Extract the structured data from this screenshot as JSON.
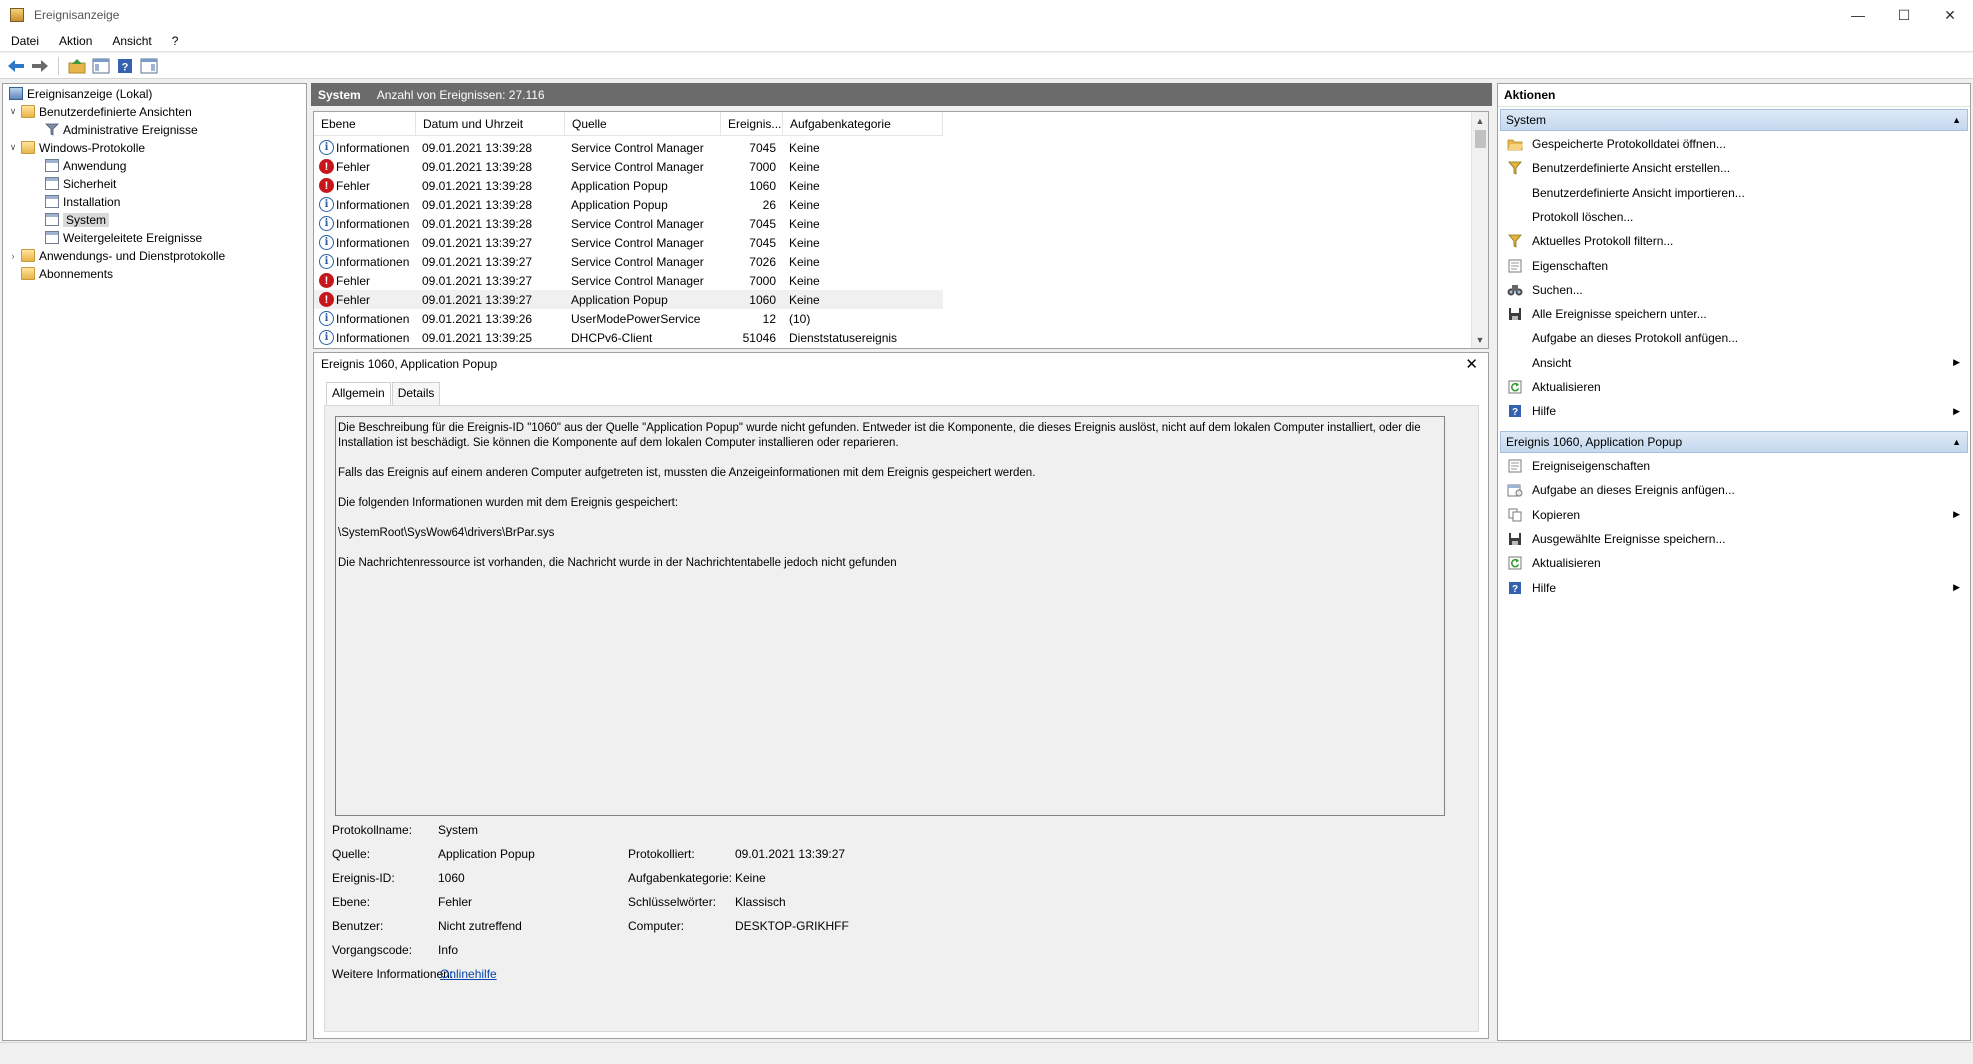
{
  "window": {
    "title": "Ereignisanzeige"
  },
  "menu": [
    "Datei",
    "Aktion",
    "Ansicht",
    "?"
  ],
  "toolbar": [
    "back-icon",
    "forward-icon",
    "up-icon",
    "show-hide-tree-icon",
    "help-icon",
    "show-hide-action-pane-icon"
  ],
  "tree": {
    "root": "Ereignisanzeige (Lokal)",
    "custom_views": "Benutzerdefinierte Ansichten",
    "admin_events": "Administrative Ereignisse",
    "windows_logs": "Windows-Protokolle",
    "app": "Anwendung",
    "security": "Sicherheit",
    "setup": "Installation",
    "system": "System",
    "forwarded": "Weitergeleitete Ereignisse",
    "app_service_logs": "Anwendungs- und Dienstprotokolle",
    "subscriptions": "Abonnements"
  },
  "middle": {
    "log_name": "System",
    "count_text": "Anzahl von Ereignissen: 27.116"
  },
  "events": {
    "columns": [
      "Ebene",
      "Datum und Uhrzeit",
      "Quelle",
      "Ereignis...",
      "Aufgabenkategorie"
    ],
    "rows": [
      {
        "level": "Informationen",
        "type": "info",
        "date": "09.01.2021 13:39:28",
        "source": "Service Control Manager",
        "id": "7045",
        "task": "Keine"
      },
      {
        "level": "Fehler",
        "type": "error",
        "date": "09.01.2021 13:39:28",
        "source": "Service Control Manager",
        "id": "7000",
        "task": "Keine"
      },
      {
        "level": "Fehler",
        "type": "error",
        "date": "09.01.2021 13:39:28",
        "source": "Application Popup",
        "id": "1060",
        "task": "Keine"
      },
      {
        "level": "Informationen",
        "type": "info",
        "date": "09.01.2021 13:39:28",
        "source": "Application Popup",
        "id": "26",
        "task": "Keine"
      },
      {
        "level": "Informationen",
        "type": "info",
        "date": "09.01.2021 13:39:28",
        "source": "Service Control Manager",
        "id": "7045",
        "task": "Keine"
      },
      {
        "level": "Informationen",
        "type": "info",
        "date": "09.01.2021 13:39:27",
        "source": "Service Control Manager",
        "id": "7045",
        "task": "Keine"
      },
      {
        "level": "Informationen",
        "type": "info",
        "date": "09.01.2021 13:39:27",
        "source": "Service Control Manager",
        "id": "7026",
        "task": "Keine"
      },
      {
        "level": "Fehler",
        "type": "error",
        "date": "09.01.2021 13:39:27",
        "source": "Service Control Manager",
        "id": "7000",
        "task": "Keine"
      },
      {
        "level": "Fehler",
        "type": "error",
        "date": "09.01.2021 13:39:27",
        "source": "Application Popup",
        "id": "1060",
        "task": "Keine"
      },
      {
        "level": "Informationen",
        "type": "info",
        "date": "09.01.2021 13:39:26",
        "source": "UserModePowerService",
        "id": "12",
        "task": "(10)"
      },
      {
        "level": "Informationen",
        "type": "info",
        "date": "09.01.2021 13:39:25",
        "source": "DHCPv6-Client",
        "id": "51046",
        "task": "Dienststatusereignis"
      }
    ]
  },
  "detail": {
    "title": "Ereignis 1060, Application Popup",
    "tabs": [
      "Allgemein",
      "Details"
    ],
    "description": [
      "Die Beschreibung für die Ereignis-ID \"1060\" aus der Quelle \"Application Popup\" wurde nicht gefunden. Entweder ist die Komponente, die dieses Ereignis auslöst, nicht auf dem lokalen Computer installiert, oder die Installation ist beschädigt. Sie können die Komponente auf dem lokalen Computer installieren oder reparieren.",
      "Falls das Ereignis auf einem anderen Computer aufgetreten ist, mussten die Anzeigeinformationen mit dem Ereignis gespeichert werden.",
      "Die folgenden Informationen wurden mit dem Ereignis gespeichert:",
      "\\SystemRoot\\SysWow64\\drivers\\BrPar.sys",
      "Die Nachrichtenressource ist vorhanden, die Nachricht wurde in der Nachrichtentabelle jedoch nicht gefunden"
    ],
    "props": {
      "log_name_label": "Protokollname:",
      "log_name": "System",
      "source_label": "Quelle:",
      "source": "Application Popup",
      "logged_label": "Protokolliert:",
      "logged": "09.01.2021 13:39:27",
      "event_id_label": "Ereignis-ID:",
      "event_id": "1060",
      "task_label": "Aufgabenkategorie:",
      "task": "Keine",
      "level_label": "Ebene:",
      "level": "Fehler",
      "keywords_label": "Schlüsselwörter:",
      "keywords": "Klassisch",
      "user_label": "Benutzer:",
      "user": "Nicht zutreffend",
      "computer_label": "Computer:",
      "computer": "DESKTOP-GRIKHFF",
      "opcode_label": "Vorgangscode:",
      "opcode": "Info",
      "more_label": "Weitere Informationen:",
      "more_link": "Onlinehilfe"
    }
  },
  "actions": {
    "title": "Aktionen",
    "section1": "System",
    "items1": [
      {
        "label": "Gespeicherte Protokolldatei öffnen...",
        "icon": "open-folder-icon"
      },
      {
        "label": "Benutzerdefinierte Ansicht erstellen...",
        "icon": "filter-icon"
      },
      {
        "label": "Benutzerdefinierte Ansicht importieren...",
        "icon": ""
      },
      {
        "label": "Protokoll löschen...",
        "icon": ""
      },
      {
        "label": "Aktuelles Protokoll filtern...",
        "icon": "filter-icon"
      },
      {
        "label": "Eigenschaften",
        "icon": "properties-icon"
      },
      {
        "label": "Suchen...",
        "icon": "binoculars-icon"
      },
      {
        "label": "Alle Ereignisse speichern unter...",
        "icon": "save-icon"
      },
      {
        "label": "Aufgabe an dieses Protokoll anfügen...",
        "icon": ""
      },
      {
        "label": "Ansicht",
        "icon": "",
        "submenu": true
      },
      {
        "label": "Aktualisieren",
        "icon": "refresh-icon"
      },
      {
        "label": "Hilfe",
        "icon": "help-icon",
        "submenu": true
      }
    ],
    "section2": "Ereignis 1060, Application Popup",
    "items2": [
      {
        "label": "Ereigniseigenschaften",
        "icon": "properties-icon"
      },
      {
        "label": "Aufgabe an dieses Ereignis anfügen...",
        "icon": "task-icon"
      },
      {
        "label": "Kopieren",
        "icon": "copy-icon",
        "submenu": true
      },
      {
        "label": "Ausgewählte Ereignisse speichern...",
        "icon": "save-icon"
      },
      {
        "label": "Aktualisieren",
        "icon": "refresh-icon"
      },
      {
        "label": "Hilfe",
        "icon": "help-icon",
        "submenu": true
      }
    ]
  }
}
